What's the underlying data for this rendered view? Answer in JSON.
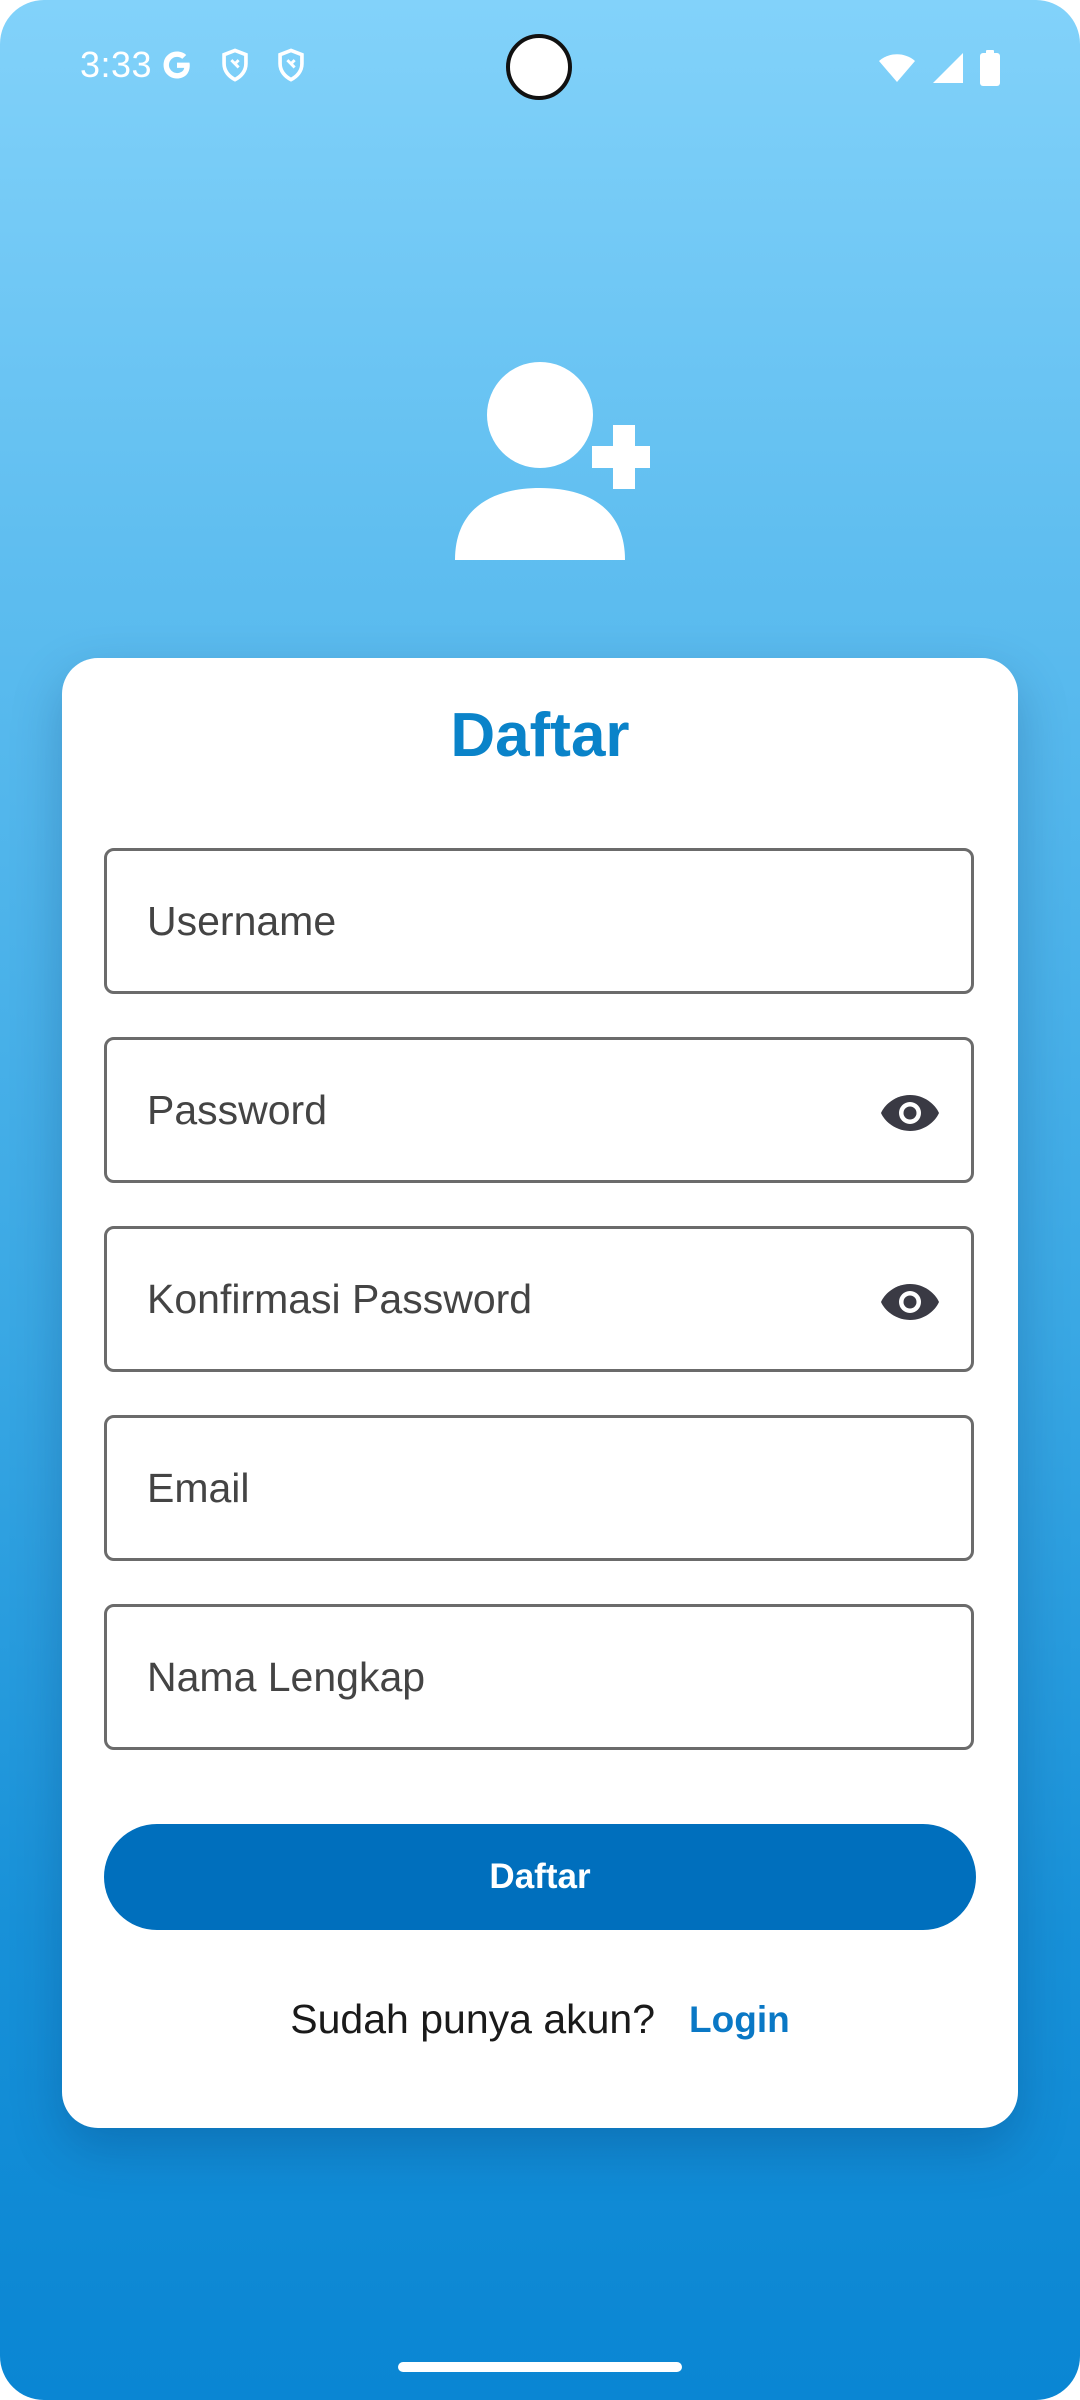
{
  "status_bar": {
    "time": "3:33",
    "left_icons": [
      "google-g-icon",
      "shield-icon",
      "shield-icon"
    ],
    "right_icons": [
      "wifi-icon",
      "cellular-signal-icon",
      "battery-icon"
    ]
  },
  "hero": {
    "icon": "person-add-icon"
  },
  "form": {
    "title": "Daftar",
    "fields": {
      "username": {
        "placeholder": "Username",
        "value": ""
      },
      "password": {
        "placeholder": "Password",
        "value": ""
      },
      "confirm_password": {
        "placeholder": "Konfirmasi Password",
        "value": ""
      },
      "email": {
        "placeholder": "Email",
        "value": ""
      },
      "full_name": {
        "placeholder": "Nama Lengkap",
        "value": ""
      }
    },
    "submit_label": "Daftar",
    "login_prompt": "Sudah punya akun?",
    "login_link": "Login"
  },
  "colors": {
    "background_top": "#82d2fa",
    "background_bottom": "#0a86d3",
    "title": "#0a83c9",
    "button": "#006fbd",
    "link": "#0a78c5"
  }
}
